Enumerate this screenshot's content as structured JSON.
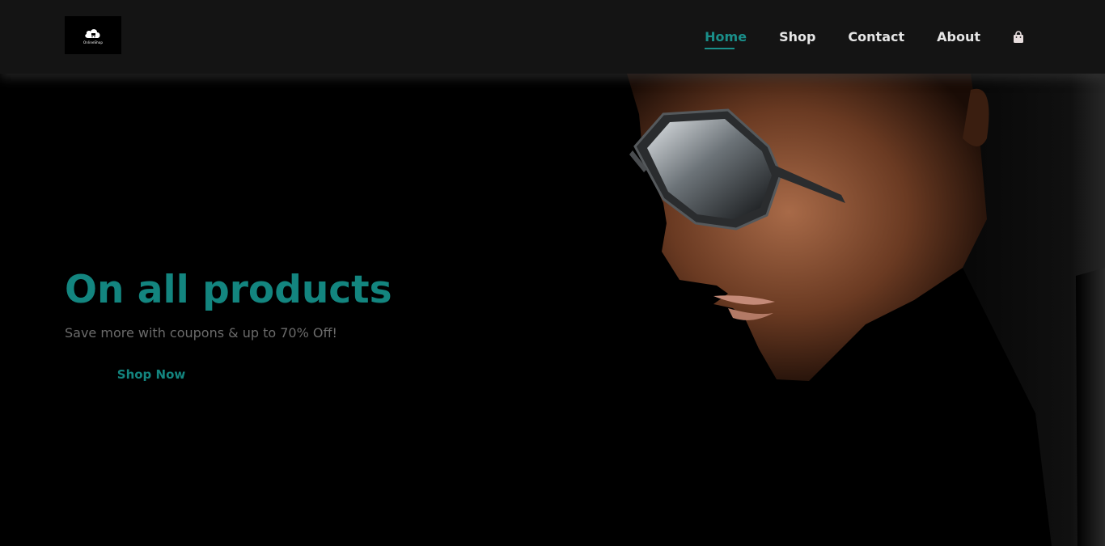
{
  "header": {
    "logo_text": "OnlineShop",
    "nav": [
      {
        "label": "Home",
        "active": true
      },
      {
        "label": "Shop"
      },
      {
        "label": "Contact"
      },
      {
        "label": "About"
      }
    ],
    "cart_icon": "shopping-bag-icon"
  },
  "hero": {
    "title": "On all products",
    "subtitle": "Save more with coupons & up to 70% Off!",
    "button_label": "Shop Now"
  },
  "colors": {
    "accent": "#13857f",
    "header_bg": "#141414",
    "page_bg": "#000000",
    "nav_text": "#e6e6e6",
    "subtitle_text": "#6b6b6b"
  }
}
